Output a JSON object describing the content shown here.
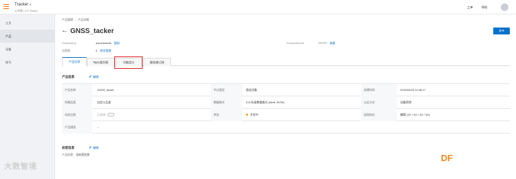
{
  "topbar": {
    "app_title": "Tracker",
    "app_subtitle": "公共版 | IoT Studio",
    "links": [
      "工单",
      "帮助"
    ]
  },
  "sidebar": {
    "items": [
      {
        "label": "主页",
        "active": false
      },
      {
        "label": "产品",
        "active": true
      },
      {
        "label": "设备",
        "active": false
      },
      {
        "label": "帐号",
        "active": false
      }
    ]
  },
  "breadcrumb": {
    "items": [
      "产品管理",
      "产品详细"
    ]
  },
  "page": {
    "title": "GNSS_tacker",
    "publish_label": "发布"
  },
  "meta": {
    "product_key_label": "ProductKey",
    "product_key_value": "a1tu24a9nr8",
    "copy_label": "复制",
    "product_secret_label": "ProductSecret",
    "product_secret_value": "********",
    "view_label": "查看",
    "device_count_label": "设备数",
    "device_count_value": "0",
    "manage_device_label": "前往管理"
  },
  "tabs": [
    {
      "label": "产品信息",
      "active": true
    },
    {
      "label": "Topic类列表",
      "active": false
    },
    {
      "label": "功能定义",
      "active": false
    },
    {
      "label": "服务端订阅",
      "active": false
    }
  ],
  "product_info": {
    "section_title": "产品信息",
    "edit_label": "编辑",
    "rows": [
      [
        {
          "label": "产品名称",
          "value": "GNSS_tacker"
        },
        {
          "label": "节点类型",
          "value": "直连设备"
        },
        {
          "label": "创建时间",
          "value": "2020/05/23 14:48:17"
        }
      ],
      [
        {
          "label": "所属品类",
          "value": "自定义品类"
        },
        {
          "label": "数据格式",
          "value": "ICA 标准数据格式 (Alink JSON)"
        },
        {
          "label": "认证方式",
          "value": "设备密钥"
        }
      ],
      [
        {
          "label": "动态注册",
          "value": "已关闭"
        },
        {
          "label": "状态",
          "value": "开发中"
        },
        {
          "label": "连网协议",
          "value": "蜂窝 (2G / 3G / 4G / 5G)"
        }
      ],
      [
        {
          "label": "产品描述",
          "value": "--"
        }
      ]
    ]
  },
  "tag_info": {
    "section_title": "标签信息",
    "edit_label": "编辑",
    "tag_label": "产品标签：",
    "tag_value": "无标签信息"
  },
  "watermarks": {
    "left": "大数智境",
    "right": "DF"
  },
  "colors": {
    "accent": "#0070cc",
    "brand_orange": "#ff6a00",
    "highlight_red": "#e02020",
    "status_dot": "#ff9a00"
  }
}
